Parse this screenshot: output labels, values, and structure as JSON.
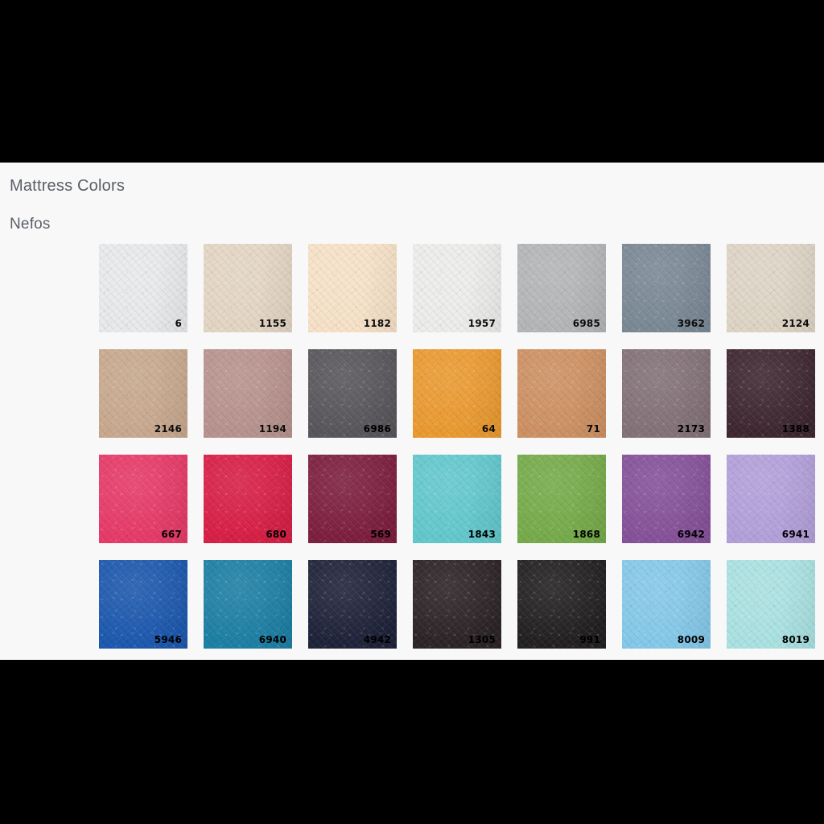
{
  "page": {
    "background_color": "#f8f8f8",
    "letterbox_color": "#000000"
  },
  "headings": {
    "title": "Mattress Colors",
    "collection": "Nefos",
    "text_color": "#5a5f66"
  },
  "swatches": {
    "rows": [
      [
        {
          "code": "6",
          "color": "#e9eaec",
          "label_tone": "light"
        },
        {
          "code": "1155",
          "color": "#e4d6c4",
          "label_tone": "light"
        },
        {
          "code": "1182",
          "color": "#f7e2c8",
          "label_tone": "light"
        },
        {
          "code": "1957",
          "color": "#edeeec",
          "label_tone": "light"
        },
        {
          "code": "6985",
          "color": "#b4b6b8",
          "label_tone": "light"
        },
        {
          "code": "3962",
          "color": "#7b8996",
          "label_tone": "light"
        },
        {
          "code": "2124",
          "color": "#ded5c6",
          "label_tone": "light"
        }
      ],
      [
        {
          "code": "2146",
          "color": "#c8a98e",
          "label_tone": "light"
        },
        {
          "code": "1194",
          "color": "#b8938e",
          "label_tone": "light"
        },
        {
          "code": "6986",
          "color": "#58565a",
          "label_tone": "dark"
        },
        {
          "code": "64",
          "color": "#eb9a30",
          "label_tone": "light"
        },
        {
          "code": "71",
          "color": "#ce9163",
          "label_tone": "light"
        },
        {
          "code": "2173",
          "color": "#837278",
          "label_tone": "dark"
        },
        {
          "code": "1388",
          "color": "#3d2630",
          "label_tone": "dark"
        }
      ],
      [
        {
          "code": "667",
          "color": "#e73a68",
          "label_tone": "dark"
        },
        {
          "code": "680",
          "color": "#d81e45",
          "label_tone": "dark"
        },
        {
          "code": "569",
          "color": "#7d1e3e",
          "label_tone": "dark"
        },
        {
          "code": "1843",
          "color": "#62c9cd",
          "label_tone": "dark"
        },
        {
          "code": "1868",
          "color": "#76ab4a",
          "label_tone": "dark"
        },
        {
          "code": "6942",
          "color": "#86519a",
          "label_tone": "dark"
        },
        {
          "code": "6941",
          "color": "#b3a0da",
          "label_tone": "dark"
        }
      ],
      [
        {
          "code": "5946",
          "color": "#1c58ae",
          "label_tone": "dark"
        },
        {
          "code": "6940",
          "color": "#1c7fa4",
          "label_tone": "dark"
        },
        {
          "code": "4942",
          "color": "#1e2239",
          "label_tone": "dark"
        },
        {
          "code": "1305",
          "color": "#2b2326",
          "label_tone": "dark"
        },
        {
          "code": "991",
          "color": "#221f20",
          "label_tone": "dark"
        },
        {
          "code": "8009",
          "color": "#85c9ea",
          "label_tone": "dark"
        },
        {
          "code": "8019",
          "color": "#abe2e2",
          "label_tone": "dark"
        }
      ]
    ]
  }
}
